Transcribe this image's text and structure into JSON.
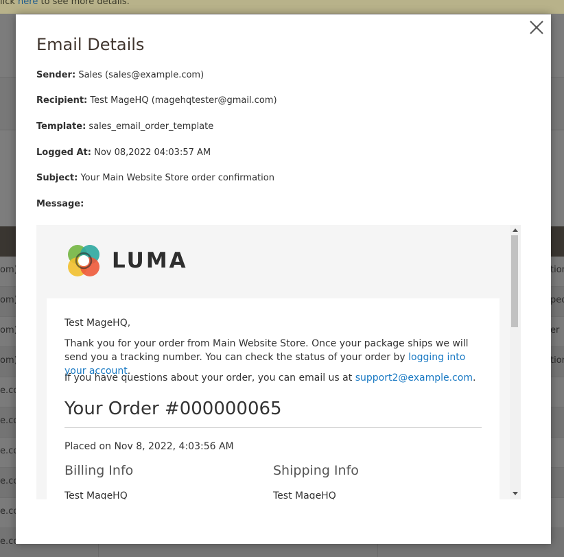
{
  "background": {
    "notice_prefix": "lick",
    "notice_link": "here",
    "notice_suffix": "to see more details.",
    "rows_left": [
      "om)",
      "om)",
      "om)",
      "om)",
      "e.co",
      "e.co",
      "e.co",
      "e.co",
      "e.co",
      "e.co"
    ],
    "rows_right": [
      "tion",
      "ped",
      "er",
      "tion",
      "",
      "",
      "",
      "",
      "",
      ""
    ]
  },
  "modal": {
    "title": "Email Details",
    "close_icon": "close-icon",
    "fields": {
      "sender_label": "Sender:",
      "sender_value": "Sales (sales@example.com)",
      "recipient_label": "Recipient:",
      "recipient_value": "Test MageHQ (magehqtester@gmail.com)",
      "template_label": "Template:",
      "template_value": "sales_email_order_template",
      "logged_label": "Logged At:",
      "logged_value": "Nov 08,2022 04:03:57 AM",
      "subject_label": "Subject:",
      "subject_value": "Your Main Website Store order confirmation",
      "message_label": "Message:"
    }
  },
  "email": {
    "logo_text": "LUMA",
    "greeting": "Test MageHQ,",
    "para1_text": "Thank you for your order from Main Website Store. Once your package ships we will send you a tracking number. You can check the status of your order by ",
    "para1_link": "logging into your account",
    "para1_end": ".",
    "para2_text": "If you have questions about your order, you can email us at ",
    "para2_link": "support2@example.com",
    "para2_end": ".",
    "order_title": "Your Order #000000065",
    "placed_on": "Placed on Nov 8, 2022, 4:03:56 AM",
    "billing_title": "Billing Info",
    "shipping_title": "Shipping Info",
    "billing_name": "Test MageHQ",
    "shipping_name": "Test MageHQ"
  },
  "colors": {
    "link": "#1979c3",
    "title": "#41362f",
    "overlay": "#7d7d7d"
  }
}
